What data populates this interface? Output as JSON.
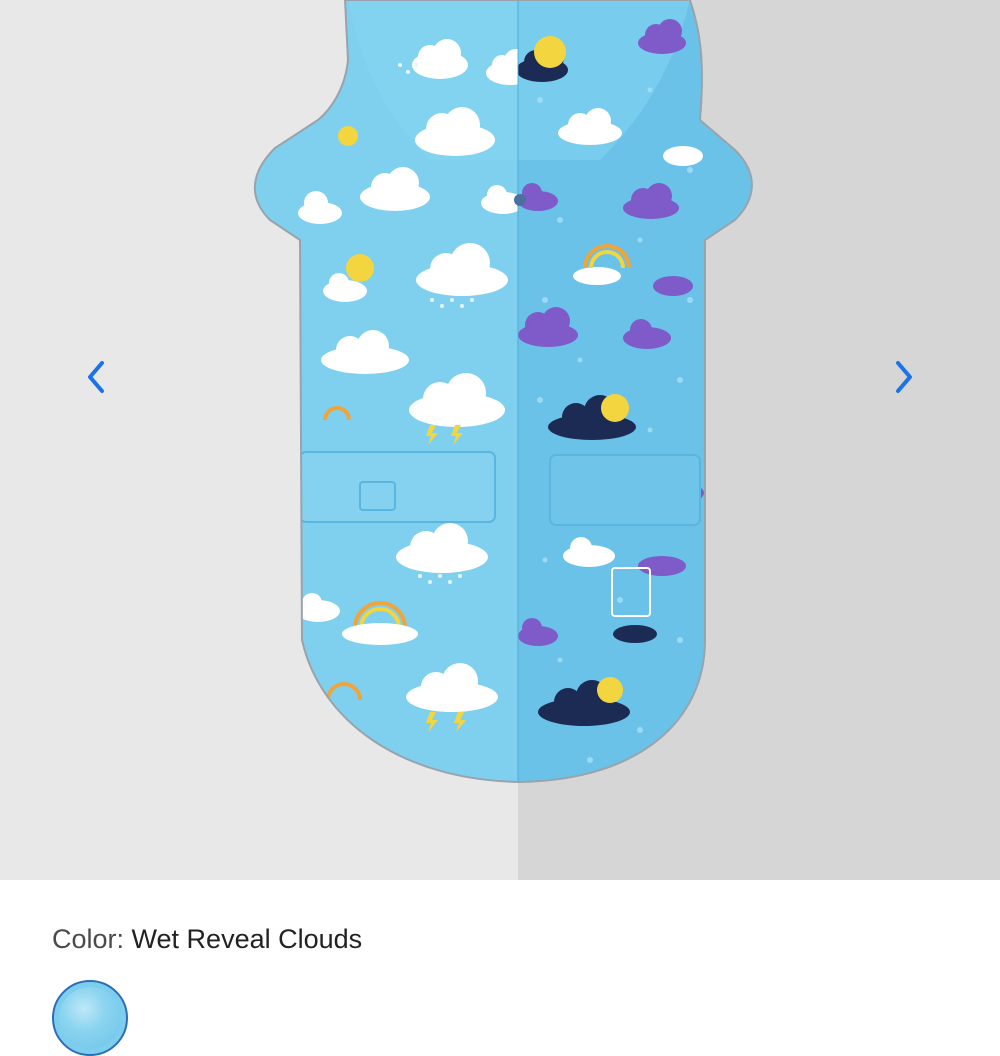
{
  "gallery": {
    "product_image_alt": "Dog raincoat with cloud print, wet reveal pattern",
    "prev_icon": "chevron-left-icon",
    "next_icon": "chevron-right-icon",
    "accent_color": "#1a73e8",
    "coat_color": "#7fd0ef",
    "wet_color": "#6bc2e8"
  },
  "product": {
    "color_label": "Color:",
    "color_value": "Wet Reveal Clouds",
    "swatch_icon": "color-swatch-icon"
  }
}
